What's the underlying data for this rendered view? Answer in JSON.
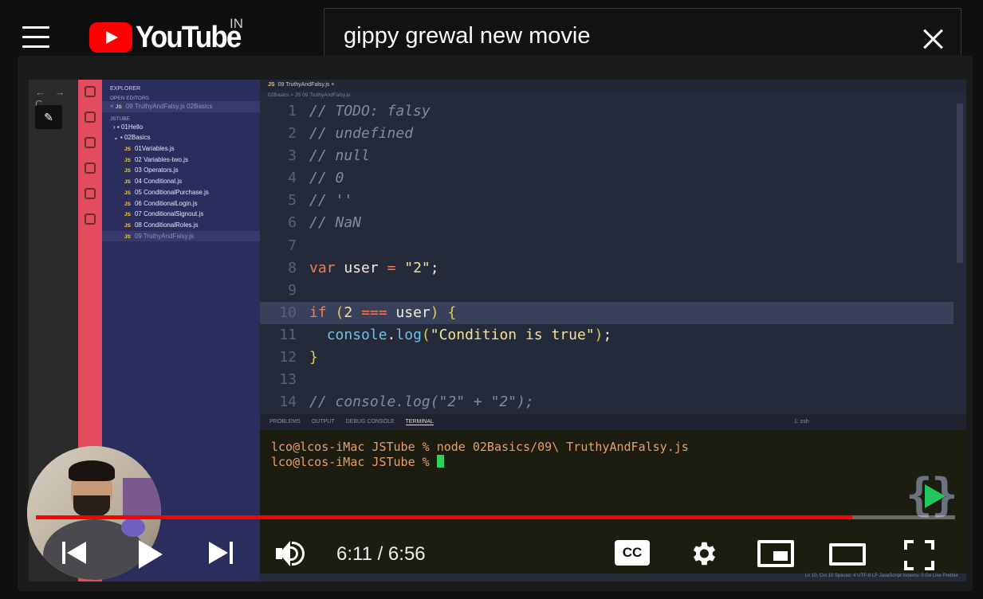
{
  "header": {
    "logo_text": "YouTube",
    "country_code": "IN",
    "search_value": "gippy grewal new movie"
  },
  "video": {
    "explorer": {
      "title": "EXPLORER",
      "open_editors": "OPEN EDITORS",
      "open_file": "09 TruthyAndFalsy.js",
      "open_file_path": "02Basics",
      "project": "JSTUBE",
      "folders": [
        "01Hello",
        "02Basics"
      ],
      "files": [
        "01Variables.js",
        "02 Variables-two.js",
        "03 Operators.js",
        "04 Conditional.js",
        "05 ConditionalPurchase.js",
        "06 ConditionalLogin.js",
        "07 ConditionalSignout.js",
        "08 ConditionalRoles.js",
        "09 TruthyAndFalsy.js"
      ]
    },
    "editor": {
      "tab": "09 TruthyAndFalsy.js",
      "breadcrumb": "02Basics > JS 09 TruthyAndFalsy.js",
      "lines": [
        {
          "n": "1",
          "html": "<span class='c'>// TODO: falsy</span>"
        },
        {
          "n": "2",
          "html": "<span class='c'>// undefined</span>"
        },
        {
          "n": "3",
          "html": "<span class='c'>// null</span>"
        },
        {
          "n": "4",
          "html": "<span class='c'>// 0</span>"
        },
        {
          "n": "5",
          "html": "<span class='c'>// ''</span>"
        },
        {
          "n": "6",
          "html": "<span class='c'>// NaN</span>"
        },
        {
          "n": "7",
          "html": ""
        },
        {
          "n": "8",
          "html": "<span class='k'>var</span> <span class='n'>user</span> <span class='o'>=</span> <span class='s'>\"2\"</span><span class='n'>;</span>"
        },
        {
          "n": "9",
          "html": ""
        },
        {
          "n": "10",
          "html": "<span class='k'>if</span> <span class='p'>(</span><span class='s'>2</span> <span class='o'>===</span> <span class='n'>user</span><span class='p'>)</span> <span class='p'>{</span>"
        },
        {
          "n": "11",
          "html": "  <span class='f'>console</span><span class='n'>.</span><span class='f'>log</span><span class='p'>(</span><span class='s'>\"Condition is true\"</span><span class='p'>)</span><span class='n'>;</span>"
        },
        {
          "n": "12",
          "html": "<span class='p'>}</span>"
        },
        {
          "n": "13",
          "html": ""
        },
        {
          "n": "14",
          "html": "<span class='c'>// console.log(\"2\" + \"2\");</span>"
        }
      ]
    },
    "terminal": {
      "tabs": [
        "PROBLEMS",
        "OUTPUT",
        "DEBUG CONSOLE",
        "TERMINAL"
      ],
      "line1": "lco@lcos-iMac JSTube % node 02Basics/09\\ TruthyAndFalsy.js",
      "line2": "lco@lcos-iMac JSTube % ",
      "shell": "1: zsh"
    },
    "status_bar": "Ln 10, Col 10   Spaces: 4   UTF-8   LF   JavaScript   Indents: 0   Go Live   Prettier"
  },
  "player": {
    "current_time": "6:11",
    "duration": "6:56",
    "time_display": "6:11 / 6:56",
    "progress_fraction": 0.888,
    "cc_label": "CC"
  },
  "colors": {
    "brand_red": "#ff0000",
    "activity_bar": "#e34b5e",
    "explorer_bg": "#2b2d5c"
  }
}
